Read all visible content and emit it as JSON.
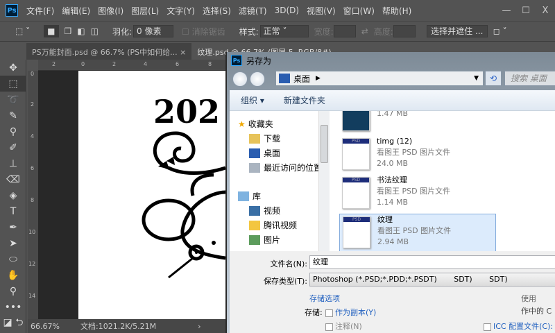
{
  "app": {
    "logo": "Ps"
  },
  "menubar": [
    "文件(F)",
    "编辑(E)",
    "图像(I)",
    "图层(L)",
    "文字(Y)",
    "选择(S)",
    "滤镜(T)",
    "3D(D)",
    "视图(V)",
    "窗口(W)",
    "帮助(H)"
  ],
  "window_controls": [
    "—",
    "☐",
    "X"
  ],
  "options": {
    "feather_label": "羽化:",
    "feather_value": "0 像素",
    "antialias": "消除锯齿",
    "style_label": "样式:",
    "style_value": "正常",
    "width_label": "宽度:",
    "height_label": "高度:",
    "select_mask": "选择并遮住 ..."
  },
  "tabs": [
    {
      "label": "PS万能封面.psd @ 66.7% (PS中如何给...",
      "close": "×"
    },
    {
      "label": "纹理.psd @ 66.7% (图层 5, RGB/8#)",
      "close": "×"
    }
  ],
  "rulers": {
    "h": [
      "2",
      "0",
      "2",
      "4",
      "6",
      "8"
    ],
    "v": [
      "0",
      "2",
      "4",
      "6",
      "8",
      "10",
      "12",
      "14"
    ]
  },
  "canvas_text": "202",
  "status": {
    "zoom": "66.67%",
    "doc": "文档:1021.2K/5.21M"
  },
  "dialog": {
    "title": "另存为",
    "address": "桌面",
    "search_placeholder": "搜索 桌面",
    "toolbar": {
      "organize": "组织 ▾",
      "new_folder": "新建文件夹"
    },
    "nav": {
      "favorites": "收藏夹",
      "items": [
        "下载",
        "桌面",
        "最近访问的位置"
      ],
      "library": "库",
      "lib_items": [
        "视频",
        "腾讯视频",
        "图片"
      ]
    },
    "files": [
      {
        "name": "",
        "type": "看图王 PSD 图片文件",
        "size": "1.47 MB"
      },
      {
        "name": "timg (12)",
        "type": "看图王 PSD 图片文件",
        "size": "24.0 MB"
      },
      {
        "name": "书法纹理",
        "type": "看图王 PSD 图片文件",
        "size": "1.14 MB"
      },
      {
        "name": "纹理",
        "type": "看图王 PSD 图片文件",
        "size": "2.94 MB",
        "selected": true
      }
    ],
    "thumb_label": "PSD",
    "form": {
      "filename_label": "文件名(N):",
      "filename": "纹理",
      "type_label": "保存类型(T):",
      "type_value": "Photoshop (*.PSD;*.PDD;*.PSDT)       SDT)       SDT)",
      "save_options": "存储选项",
      "save_label": "存储:",
      "as_copy": "作为副本(Y)",
      "notes": "注释(N)",
      "icc": "ICC 配置文件(C):",
      "side1": "使用",
      "side2": "作中的 C"
    }
  }
}
